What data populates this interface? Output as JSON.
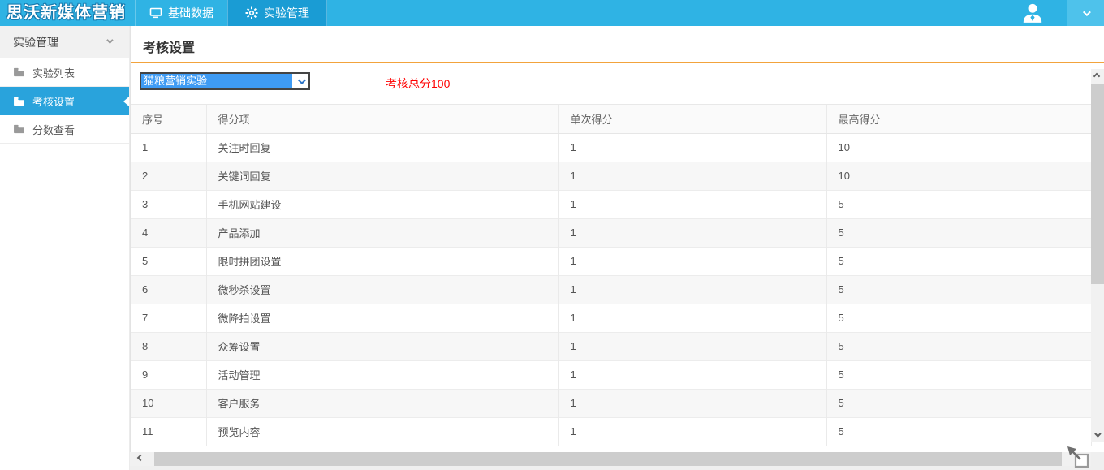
{
  "topbar": {
    "logo_text": "思沃新媒体营销",
    "menu_items": [
      {
        "label": "基础数据",
        "icon": "monitor-icon"
      },
      {
        "label": "实验管理",
        "icon": "gear-icon"
      }
    ]
  },
  "sidebar": {
    "group": {
      "label": "实验管理"
    },
    "items": [
      {
        "label": "实验列表",
        "icon": "folder-icon",
        "active": false
      },
      {
        "label": "考核设置",
        "icon": "folder-icon",
        "active": true
      },
      {
        "label": "分数查看",
        "icon": "folder-icon",
        "active": false
      }
    ]
  },
  "main": {
    "page_title": "考核设置",
    "experiment_select": {
      "value": "猫粮营销实验"
    },
    "total_score_text": "考核总分100",
    "table": {
      "headers": [
        "序号",
        "得分项",
        "单次得分",
        "最高得分"
      ],
      "rows": [
        {
          "no": "1",
          "item": "关注时回复",
          "single": "1",
          "max": "10"
        },
        {
          "no": "2",
          "item": "关键词回复",
          "single": "1",
          "max": "10"
        },
        {
          "no": "3",
          "item": "手机网站建设",
          "single": "1",
          "max": "5"
        },
        {
          "no": "4",
          "item": "产品添加",
          "single": "1",
          "max": "5"
        },
        {
          "no": "5",
          "item": "限时拼团设置",
          "single": "1",
          "max": "5"
        },
        {
          "no": "6",
          "item": "微秒杀设置",
          "single": "1",
          "max": "5"
        },
        {
          "no": "7",
          "item": "微降拍设置",
          "single": "1",
          "max": "5"
        },
        {
          "no": "8",
          "item": "众筹设置",
          "single": "1",
          "max": "5"
        },
        {
          "no": "9",
          "item": "活动管理",
          "single": "1",
          "max": "5"
        },
        {
          "no": "10",
          "item": "客户服务",
          "single": "1",
          "max": "5"
        },
        {
          "no": "11",
          "item": "预览内容",
          "single": "1",
          "max": "5"
        }
      ]
    }
  },
  "colors": {
    "topbar_blue": "#2fb3e4",
    "active_tab_blue": "#1a9cd4",
    "active_sidebar_blue": "#29a3dc",
    "accent_orange": "#f2a33c",
    "selection_blue": "#3e9bf4",
    "total_score_red": "#ff0000"
  }
}
